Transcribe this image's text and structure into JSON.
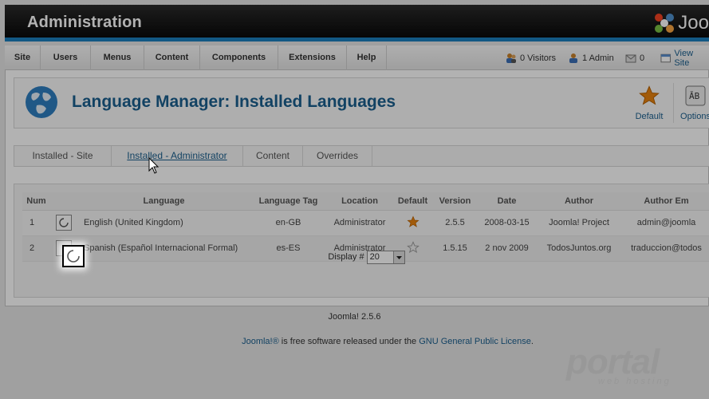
{
  "header": {
    "title": "Administration",
    "logo_text": "Joo"
  },
  "menu": {
    "items": [
      "Site",
      "Users",
      "Menus",
      "Content",
      "Components",
      "Extensions",
      "Help"
    ],
    "visitors": "0 Visitors",
    "admins": "1 Admin",
    "messages": "0",
    "view_site": "View Site"
  },
  "toolbar": {
    "title": "Language Manager: Installed Languages",
    "default_label": "Default",
    "options_label": "Options"
  },
  "tabs": [
    "Installed - Site",
    "Installed - Administrator",
    "Content",
    "Overrides"
  ],
  "active_tab": "Installed - Administrator",
  "table": {
    "headers": [
      "Num",
      "",
      "Language",
      "Language Tag",
      "Location",
      "Default",
      "Version",
      "Date",
      "Author",
      "Author Em"
    ],
    "rows": [
      {
        "num": "1",
        "language": "English (United Kingdom)",
        "tag": "en-GB",
        "location": "Administrator",
        "default": true,
        "version": "2.5.5",
        "date": "2008-03-15",
        "author": "Joomla! Project",
        "email": "admin@joomla"
      },
      {
        "num": "2",
        "language": "Spanish (Español Internacional Formal)",
        "tag": "es-ES",
        "location": "Administrator",
        "default": false,
        "version": "1.5.15",
        "date": "2 nov 2009",
        "author": "TodosJuntos.org",
        "email": "traduccion@todos"
      }
    ],
    "display_label": "Display #",
    "display_value": "20"
  },
  "footer": {
    "version": "Joomla! 2.5.6",
    "license_link": "Joomla!®",
    "license_text": " is free software released under the ",
    "gpl_link": "GNU General Public License",
    "license_end": "."
  },
  "watermark": {
    "brand": "portal",
    "sub": "web hosting"
  },
  "colors": {
    "accent": "#1a7fbe",
    "title": "#1b5f8e",
    "star": "#e8830f"
  }
}
